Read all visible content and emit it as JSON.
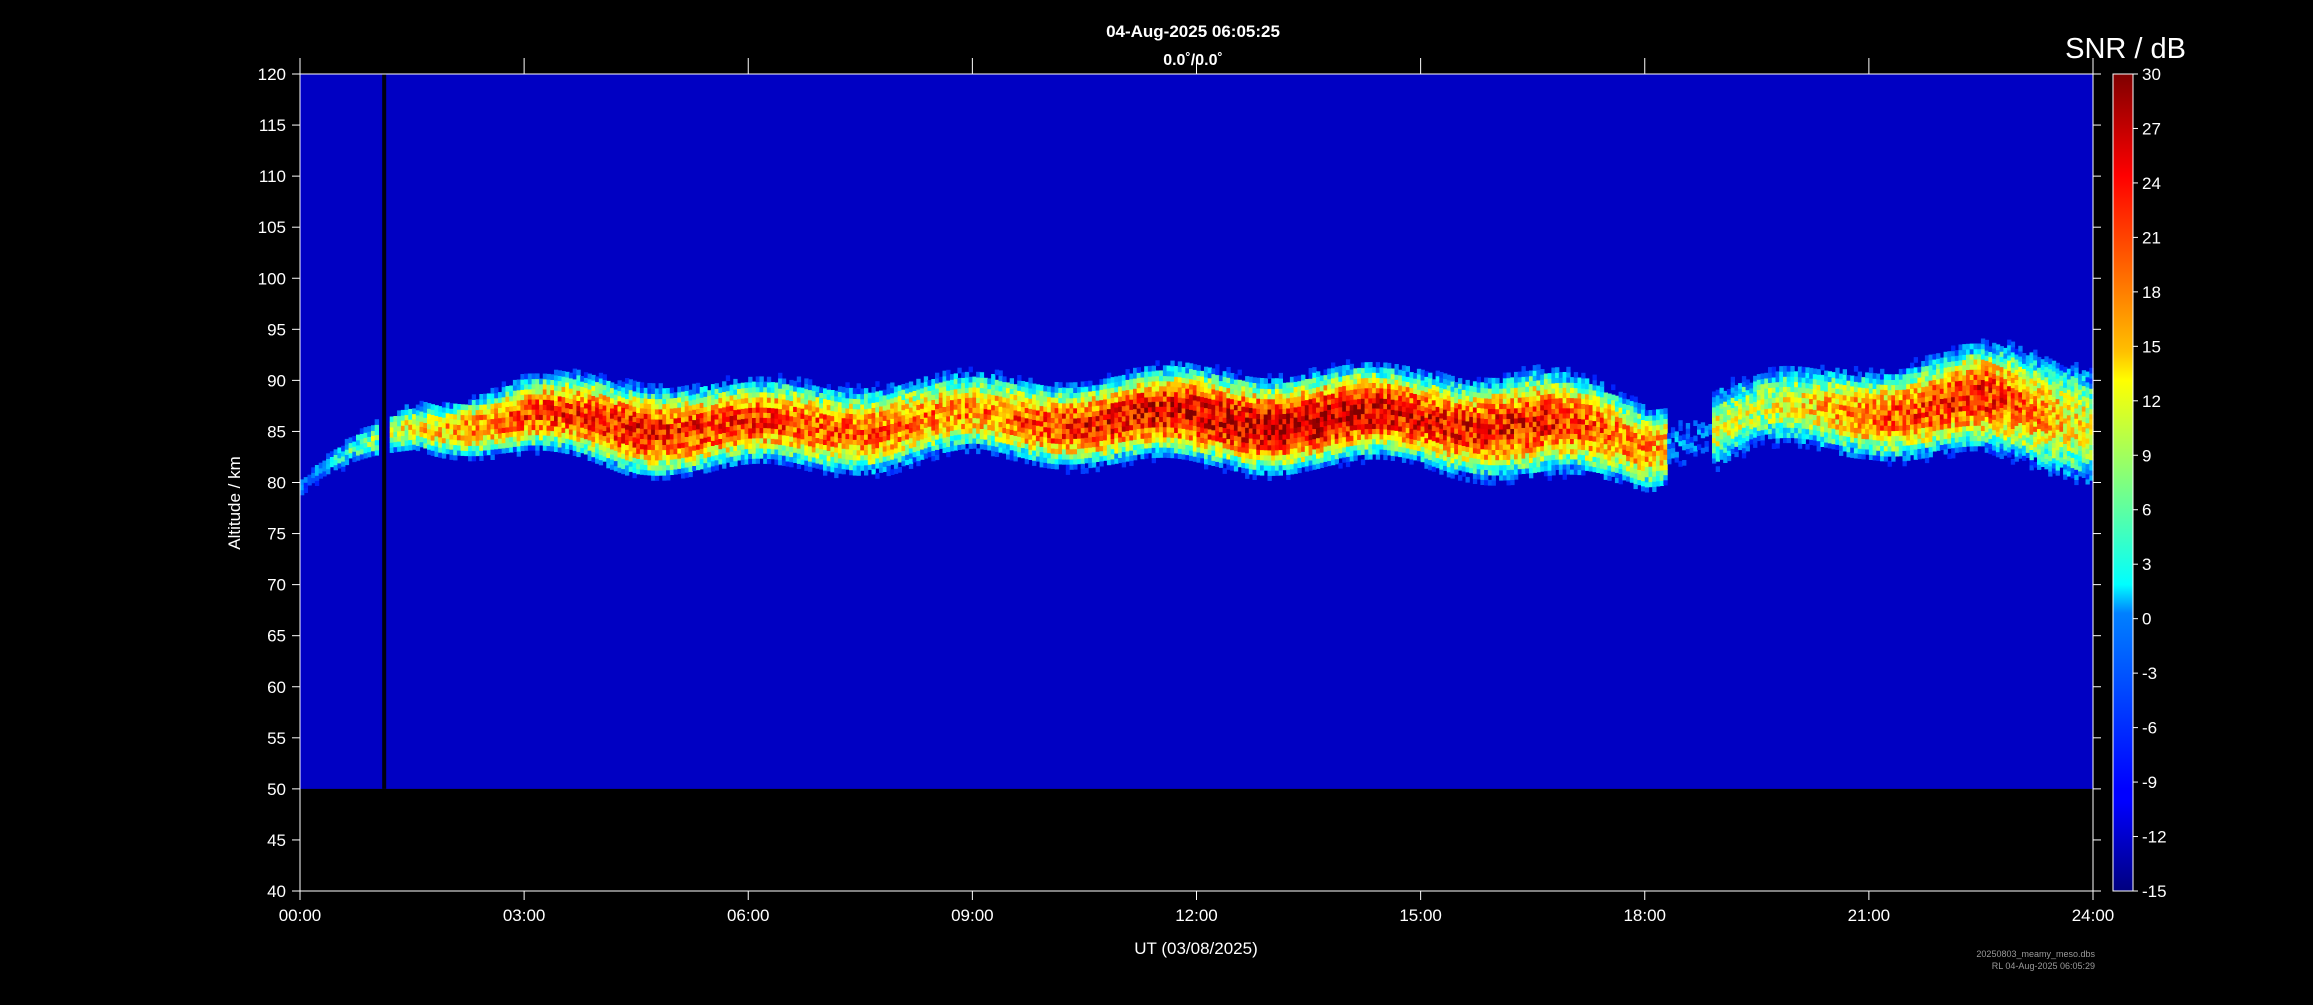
{
  "header": {
    "datetime": "04-Aug-2025 06:05:25",
    "pointing": "0.0˚/0.0˚"
  },
  "footer": {
    "filename": "20250803_meamy_meso.dbs",
    "stamp": "RL 04-Aug-2025 06:05:29"
  },
  "chart_data": {
    "type": "heatmap",
    "title": "04-Aug-2025 06:05:25",
    "subtitle": "0.0˚/0.0˚",
    "xlabel": "UT (03/08/2025)",
    "ylabel": "Altitude / km",
    "x_range_hours": [
      0,
      24
    ],
    "xticks": [
      "00:00",
      "03:00",
      "06:00",
      "09:00",
      "12:00",
      "15:00",
      "18:00",
      "21:00",
      "24:00"
    ],
    "ylim": [
      40,
      120
    ],
    "yticks": [
      40,
      45,
      50,
      55,
      60,
      65,
      70,
      75,
      80,
      85,
      90,
      95,
      100,
      105,
      110,
      115,
      120
    ],
    "data_altitude_range": [
      50,
      120
    ],
    "background_snr": -12,
    "gap_hour": 1.1,
    "colorbar": {
      "label": "SNR / dB",
      "range": [
        -15,
        30
      ],
      "ticks": [
        -15,
        -12,
        -9,
        -6,
        -3,
        0,
        3,
        6,
        9,
        12,
        15,
        18,
        21,
        24,
        27,
        30
      ],
      "colormap": "jet"
    },
    "echo_layer": {
      "description_time_hours": [
        0,
        1.5,
        3,
        4.5,
        6,
        7.5,
        9,
        10.5,
        12,
        13.5,
        15,
        16.5,
        18,
        19.5,
        21,
        22.5,
        24
      ],
      "center_altitude_km": [
        79.5,
        85.5,
        86,
        85.5,
        85,
        85.5,
        86,
        86,
        86,
        86,
        86,
        85.5,
        83.5,
        86.5,
        87,
        87.5,
        86
      ],
      "thickness_km": [
        1,
        2.5,
        4,
        5,
        4.5,
        5,
        4.5,
        4.5,
        5,
        5,
        5,
        6,
        5,
        5,
        5,
        6,
        8
      ],
      "peak_snr_db": [
        -4,
        14,
        22,
        24,
        22,
        20,
        18,
        24,
        26,
        28,
        24,
        24,
        18,
        10,
        20,
        24,
        12
      ]
    }
  }
}
